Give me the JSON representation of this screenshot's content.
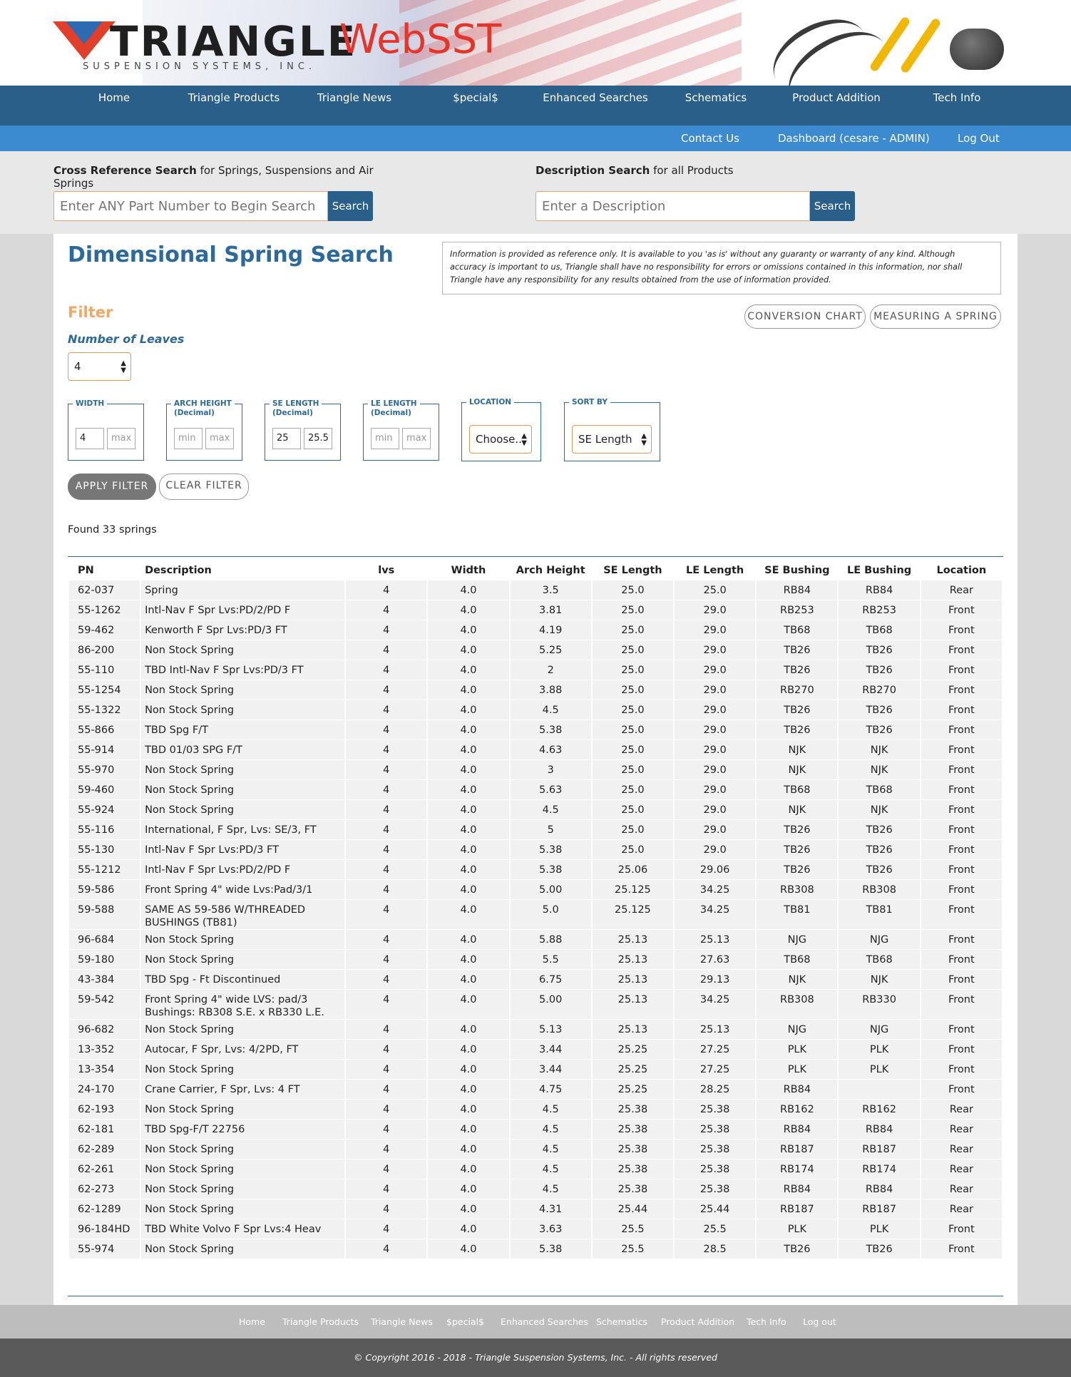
{
  "brand": {
    "logo_word": "TRIANGLE",
    "logo_sub": "SUSPENSION SYSTEMS, INC.",
    "web_title": "WebSST"
  },
  "main_nav": [
    "Home",
    "Triangle Products",
    "Triangle News",
    "$pecial$",
    "Enhanced Searches",
    "Schematics",
    "Product Addition",
    "Tech Info"
  ],
  "sub_nav": [
    "Contact Us",
    "Dashboard (cesare - ADMIN)",
    "Log Out"
  ],
  "cross_search": {
    "label_bold": "Cross Reference Search",
    "label_rest": " for Springs, Suspensions and Air Springs",
    "placeholder": "Enter ANY Part Number to Begin Search",
    "button": "Search"
  },
  "desc_search": {
    "label_bold": "Description Search",
    "label_rest": " for all Products",
    "placeholder": "Enter a Description",
    "button": "Search"
  },
  "page": {
    "title": "Dimensional Spring Search",
    "disclaimer": "Information is provided as reference only. It is available to you 'as is' without any guaranty or warranty of any kind. Although accuracy is important to us, Triangle shall have no responsibility for errors or omissions contained in this information, nor shall Triangle have any responsibility for any results obtained from the use of information provided."
  },
  "filter": {
    "heading": "Filter",
    "conversion_chart": "CONVERSION CHART",
    "measuring_spring": "MEASURING A SPRING",
    "leaves_label": "Number of Leaves",
    "leaves_value": "4",
    "width": {
      "legend": "WIDTH",
      "min": "4",
      "max": "max"
    },
    "arch": {
      "legend": "ARCH HEIGHT",
      "legend2": "(Decimal)",
      "min": "min",
      "max": "max"
    },
    "se": {
      "legend": "SE LENGTH",
      "legend2": "(Decimal)",
      "min": "25",
      "max": "25.5"
    },
    "le": {
      "legend": "LE LENGTH",
      "legend2": "(Decimal)",
      "min": "min",
      "max": "max"
    },
    "location": {
      "legend": "LOCATION",
      "value": "Choose..."
    },
    "sort": {
      "legend": "SORT BY",
      "value": "SE Length"
    },
    "apply": "APPLY FILTER",
    "clear": "CLEAR FILTER",
    "found": "Found 33 springs"
  },
  "table": {
    "headers": [
      "PN",
      "Description",
      "lvs",
      "Width",
      "Arch Height",
      "SE Length",
      "LE Length",
      "SE Bushing",
      "LE Bushing",
      "Location"
    ],
    "rows": [
      [
        "62-037",
        "Spring",
        "4",
        "4.0",
        "3.5",
        "25.0",
        "25.0",
        "RB84",
        "RB84",
        "Rear"
      ],
      [
        "55-1262",
        "Intl-Nav F Spr Lvs:PD/2/PD F",
        "4",
        "4.0",
        "3.81",
        "25.0",
        "29.0",
        "RB253",
        "RB253",
        "Front"
      ],
      [
        "59-462",
        "Kenworth F Spr Lvs:PD/3 FT",
        "4",
        "4.0",
        "4.19",
        "25.0",
        "29.0",
        "TB68",
        "TB68",
        "Front"
      ],
      [
        "86-200",
        "Non Stock Spring",
        "4",
        "4.0",
        "5.25",
        "25.0",
        "29.0",
        "TB26",
        "TB26",
        "Front"
      ],
      [
        "55-110",
        "TBD Intl-Nav F Spr Lvs:PD/3 FT",
        "4",
        "4.0",
        "2",
        "25.0",
        "29.0",
        "TB26",
        "TB26",
        "Front"
      ],
      [
        "55-1254",
        "Non Stock Spring",
        "4",
        "4.0",
        "3.88",
        "25.0",
        "29.0",
        "RB270",
        "RB270",
        "Front"
      ],
      [
        "55-1322",
        "Non Stock Spring",
        "4",
        "4.0",
        "4.5",
        "25.0",
        "29.0",
        "TB26",
        "TB26",
        "Front"
      ],
      [
        "55-866",
        "TBD Spg F/T",
        "4",
        "4.0",
        "5.38",
        "25.0",
        "29.0",
        "TB26",
        "TB26",
        "Front"
      ],
      [
        "55-914",
        "TBD 01/03 SPG F/T",
        "4",
        "4.0",
        "4.63",
        "25.0",
        "29.0",
        "NJK",
        "NJK",
        "Front"
      ],
      [
        "55-970",
        "Non Stock Spring",
        "4",
        "4.0",
        "3",
        "25.0",
        "29.0",
        "NJK",
        "NJK",
        "Front"
      ],
      [
        "59-460",
        "Non Stock Spring",
        "4",
        "4.0",
        "5.63",
        "25.0",
        "29.0",
        "TB68",
        "TB68",
        "Front"
      ],
      [
        "55-924",
        "Non Stock Spring",
        "4",
        "4.0",
        "4.5",
        "25.0",
        "29.0",
        "NJK",
        "NJK",
        "Front"
      ],
      [
        "55-116",
        "International, F Spr, Lvs: SE/3, FT",
        "4",
        "4.0",
        "5",
        "25.0",
        "29.0",
        "TB26",
        "TB26",
        "Front"
      ],
      [
        "55-130",
        "Intl-Nav F Spr Lvs:PD/3 FT",
        "4",
        "4.0",
        "5.38",
        "25.0",
        "29.0",
        "TB26",
        "TB26",
        "Front"
      ],
      [
        "55-1212",
        "Intl-Nav F Spr Lvs:PD/2/PD F",
        "4",
        "4.0",
        "5.38",
        "25.06",
        "29.06",
        "TB26",
        "TB26",
        "Front"
      ],
      [
        "59-586",
        "Front Spring 4\" wide Lvs:Pad/3/1",
        "4",
        "4.0",
        "5.00",
        "25.125",
        "34.25",
        "RB308",
        "RB308",
        "Front"
      ],
      [
        "59-588",
        "SAME AS 59-586 W/THREADED BUSHINGS (TB81)",
        "4",
        "4.0",
        "5.0",
        "25.125",
        "34.25",
        "TB81",
        "TB81",
        "Front"
      ],
      [
        "96-684",
        "Non Stock Spring",
        "4",
        "4.0",
        "5.88",
        "25.13",
        "25.13",
        "NJG",
        "NJG",
        "Front"
      ],
      [
        "59-180",
        "Non Stock Spring",
        "4",
        "4.0",
        "5.5",
        "25.13",
        "27.63",
        "TB68",
        "TB68",
        "Front"
      ],
      [
        "43-384",
        "TBD Spg - Ft Discontinued",
        "4",
        "4.0",
        "6.75",
        "25.13",
        "29.13",
        "NJK",
        "NJK",
        "Front"
      ],
      [
        "59-542",
        "Front Spring 4\" wide LVS: pad/3 Bushings: RB308 S.E. x RB330 L.E.",
        "4",
        "4.0",
        "5.00",
        "25.13",
        "34.25",
        "RB308",
        "RB330",
        "Front"
      ],
      [
        "96-682",
        "Non Stock Spring",
        "4",
        "4.0",
        "5.13",
        "25.13",
        "25.13",
        "NJG",
        "NJG",
        "Front"
      ],
      [
        "13-352",
        "Autocar, F Spr, Lvs: 4/2PD, FT",
        "4",
        "4.0",
        "3.44",
        "25.25",
        "27.25",
        "PLK",
        "PLK",
        "Front"
      ],
      [
        "13-354",
        "Non Stock Spring",
        "4",
        "4.0",
        "3.44",
        "25.25",
        "27.25",
        "PLK",
        "PLK",
        "Front"
      ],
      [
        "24-170",
        "Crane Carrier, F Spr, Lvs: 4 FT",
        "4",
        "4.0",
        "4.75",
        "25.25",
        "28.25",
        "RB84",
        "",
        "Front"
      ],
      [
        "62-193",
        "Non Stock Spring",
        "4",
        "4.0",
        "4.5",
        "25.38",
        "25.38",
        "RB162",
        "RB162",
        "Rear"
      ],
      [
        "62-181",
        "TBD Spg-F/T 22756",
        "4",
        "4.0",
        "4.5",
        "25.38",
        "25.38",
        "RB84",
        "RB84",
        "Rear"
      ],
      [
        "62-289",
        "Non Stock Spring",
        "4",
        "4.0",
        "4.5",
        "25.38",
        "25.38",
        "RB187",
        "RB187",
        "Rear"
      ],
      [
        "62-261",
        "Non Stock Spring",
        "4",
        "4.0",
        "4.5",
        "25.38",
        "25.38",
        "RB174",
        "RB174",
        "Rear"
      ],
      [
        "62-273",
        "Non Stock Spring",
        "4",
        "4.0",
        "4.5",
        "25.38",
        "25.38",
        "RB84",
        "RB84",
        "Rear"
      ],
      [
        "62-1289",
        "Non Stock Spring",
        "4",
        "4.0",
        "4.31",
        "25.44",
        "25.44",
        "RB187",
        "RB187",
        "Rear"
      ],
      [
        "96-184HD",
        "TBD White Volvo F Spr Lvs:4 Heav",
        "4",
        "4.0",
        "3.63",
        "25.5",
        "25.5",
        "PLK",
        "PLK",
        "Front"
      ],
      [
        "55-974",
        "Non Stock Spring",
        "4",
        "4.0",
        "5.38",
        "25.5",
        "28.5",
        "TB26",
        "TB26",
        "Front"
      ]
    ]
  },
  "footer": {
    "links": [
      "Home",
      "Triangle Products",
      "Triangle News",
      "$pecial$",
      "Enhanced Searches",
      "Schematics",
      "Product Addition",
      "Tech Info",
      "Log out"
    ],
    "copyright": "© Copyright 2016 - 2018 - Triangle Suspension Systems, Inc. - All rights reserved"
  }
}
